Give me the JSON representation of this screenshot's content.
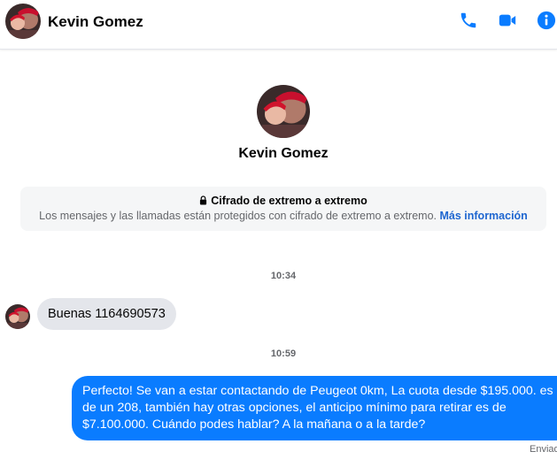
{
  "header": {
    "contact_name": "Kevin Gomez",
    "icons": [
      "phone-icon",
      "video-camera-icon",
      "info-icon"
    ],
    "accent_color": "#0a7cff"
  },
  "profile": {
    "name": "Kevin Gomez"
  },
  "encryption_notice": {
    "title": "Cifrado de extremo a extremo",
    "body": "Los mensajes y las llamadas están protegidos con cifrado de extremo a extremo.",
    "link": "Más información"
  },
  "messages": [
    {
      "timestamp": "10:34",
      "direction": "incoming",
      "text": "Buenas 1164690573"
    },
    {
      "timestamp": "10:59",
      "direction": "outgoing",
      "text": "Perfecto!  Se van a estar contactando de Peugeot 0km, La cuota desde $195.000. es de un 208, también hay otras opciones, el anticipo mínimo para retirar es de $7.100.000. Cuándo podes hablar? A la mañana o a la tarde?",
      "status": "Enviado"
    }
  ]
}
